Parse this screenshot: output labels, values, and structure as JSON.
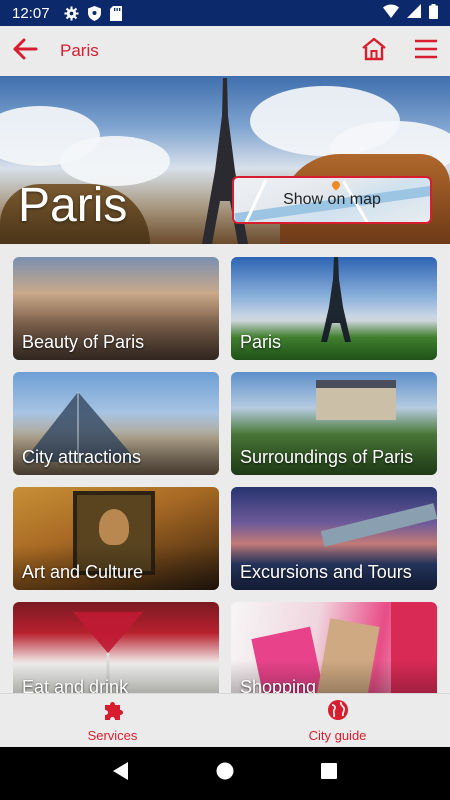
{
  "status_bar": {
    "time": "12:07"
  },
  "app_bar": {
    "title": "Paris"
  },
  "hero": {
    "title": "Paris",
    "map_button_label": "Show on map"
  },
  "tiles": [
    {
      "label": "Beauty of Paris"
    },
    {
      "label": "Paris"
    },
    {
      "label": "City attractions"
    },
    {
      "label": "Surroundings of Paris"
    },
    {
      "label": "Art and Culture"
    },
    {
      "label": "Excursions and Tours"
    },
    {
      "label": "Eat and drink"
    },
    {
      "label": "Shopping"
    }
  ],
  "bottom_nav": {
    "services_label": "Services",
    "city_guide_label": "City guide"
  },
  "colors": {
    "accent": "#d81e2e",
    "status_bar": "#0c2a6b",
    "background": "#ebebeb"
  },
  "icons": {
    "status": [
      "gear-icon",
      "shield-icon",
      "sd-card-icon",
      "wifi-icon",
      "signal-icon",
      "battery-icon"
    ],
    "app_bar": [
      "arrow-back-icon",
      "home-icon",
      "menu-icon"
    ],
    "bottom_nav": [
      "puzzle-icon",
      "globe-icon"
    ],
    "system_nav": [
      "back-triangle-icon",
      "home-circle-icon",
      "recents-square-icon"
    ]
  }
}
